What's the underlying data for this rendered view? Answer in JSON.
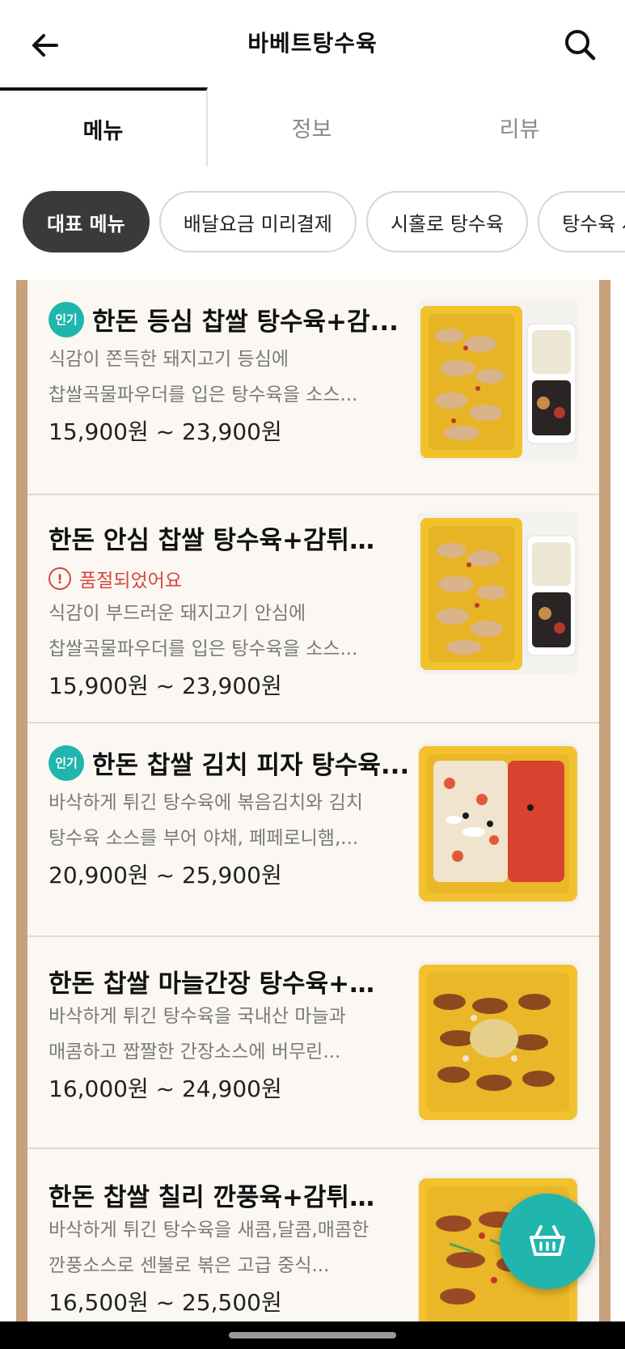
{
  "header": {
    "title": "바베트탕수육",
    "back_icon": "arrow-left-icon",
    "search_icon": "search-icon"
  },
  "tabs": [
    {
      "label": "메뉴",
      "active": true
    },
    {
      "label": "정보",
      "active": false
    },
    {
      "label": "리뷰",
      "active": false
    }
  ],
  "chips": [
    {
      "label": "대표 메뉴",
      "active": true
    },
    {
      "label": "배달요금 미리결제"
    },
    {
      "label": "시홀로 탕수육"
    },
    {
      "label": "탕수육 세트"
    }
  ],
  "menu_items": [
    {
      "badge": "인기",
      "name": "한돈 등심 찹쌀 탕수육+감...",
      "soldout": "",
      "desc1": "식감이 쫀득한 돼지고기 등심에",
      "desc2": "찹쌀곡물파우더를 입은 탕수육을 소스...",
      "price": "15,900원 ~ 23,900원",
      "thumb": "tangsuyuk-box"
    },
    {
      "badge": "",
      "name": "한돈 안심 찹쌀 탕수육+감튀+...",
      "soldout": "품절되었어요",
      "desc1": "식감이 부드러운 돼지고기 안심에",
      "desc2": "찹쌀곡물파우더를 입은 탕수육을 소스...",
      "price": "15,900원 ~ 23,900원",
      "thumb": "tangsuyuk-box"
    },
    {
      "badge": "인기",
      "name": "한돈 찹쌀 김치 피자 탕수육...",
      "soldout": "",
      "desc1": "바삭하게 튀긴 탕수육에 볶음김치와 김치",
      "desc2": "탕수육 소스를 부어 야채, 페페로니햄,...",
      "price": "20,900원 ~ 25,900원",
      "thumb": "kimchi-pizza-box"
    },
    {
      "badge": "",
      "name": "한돈 찹쌀 마늘간장 탕수육+감...",
      "soldout": "",
      "desc1": "바삭하게 튀긴 탕수육을 국내산 마늘과",
      "desc2": "매콤하고 짭짤한 간장소스에 버무린...",
      "price": "16,000원 ~ 24,900원",
      "thumb": "garlic-soy-box"
    },
    {
      "badge": "",
      "name": "한돈 찹쌀 칠리 깐풍육+감튀+...",
      "soldout": "",
      "desc1": "바삭하게 튀긴 탕수육을 새콤,달콤,매콤한",
      "desc2": "깐풍소스로 센불로 볶은 고급 중식...",
      "price": "16,500원 ~ 25,500원",
      "thumb": "chili-box"
    }
  ],
  "cart": {
    "icon": "basket-icon"
  },
  "colors": {
    "accent": "#20b5ad",
    "soldout": "#d9453e",
    "frame": "#c7a07c",
    "box": "#f2c12e"
  }
}
